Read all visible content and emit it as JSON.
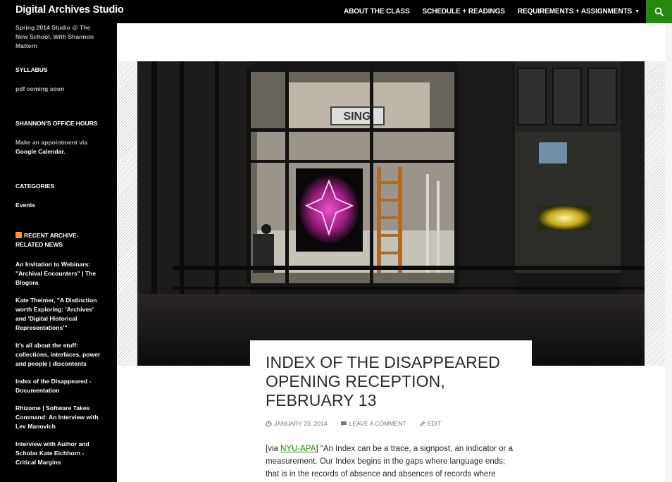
{
  "header": {
    "site_title": "Digital Archives Studio",
    "nav": [
      {
        "label": "ABOUT THE CLASS"
      },
      {
        "label": "SCHEDULE + READINGS"
      },
      {
        "label": "REQUIREMENTS + ASSIGNMENTS"
      }
    ],
    "search_icon": "search-icon",
    "accent_color": "#24890d"
  },
  "sidebar": {
    "tagline": "Spring 2014 Studio @ The New School. With Shannon Mattern",
    "syllabus": {
      "title": "SYLLABUS",
      "text": "pdf coming soon"
    },
    "office_hours": {
      "title": "SHANNON'S OFFICE HOURS",
      "text_before": "Make an appointment via ",
      "link": "Google Calendar",
      "text_after": "."
    },
    "categories": {
      "title": "CATEGORIES",
      "items": [
        "Events"
      ]
    },
    "news": {
      "title": "RECENT ARCHIVE-RELATED NEWS",
      "items": [
        "An Invitation to Webinars: \"Archival Encounters\" | The Blogora",
        "Kate Theimer, \"A Distinction worth Exploring: 'Archives' and 'Digital Historical Representations'\"",
        "It's all about the stuff: collections, interfaces, power and people | discontents",
        "Index of the Disappeared - Documentation",
        "Rhizome | Software Takes Command: An Interview with Lev Manovich",
        "Interview with Author and Scholar Kate Eichhorn - Critical Margins"
      ]
    }
  },
  "post": {
    "title": "INDEX OF THE DISAPPEARED OPENING RECEPTION, FEBRUARY 13",
    "date": "JANUARY 23, 2014",
    "comment": "LEAVE A COMMENT",
    "edit": "EDIT",
    "excerpt_before": "[via ",
    "excerpt_link": "NYU-APA",
    "excerpt_after": "] \"An Index can be a trace, a signpost, an indicator or a measurement. Our Index begins in the gaps where language ends; that is in the records of absence and absences of records where"
  }
}
